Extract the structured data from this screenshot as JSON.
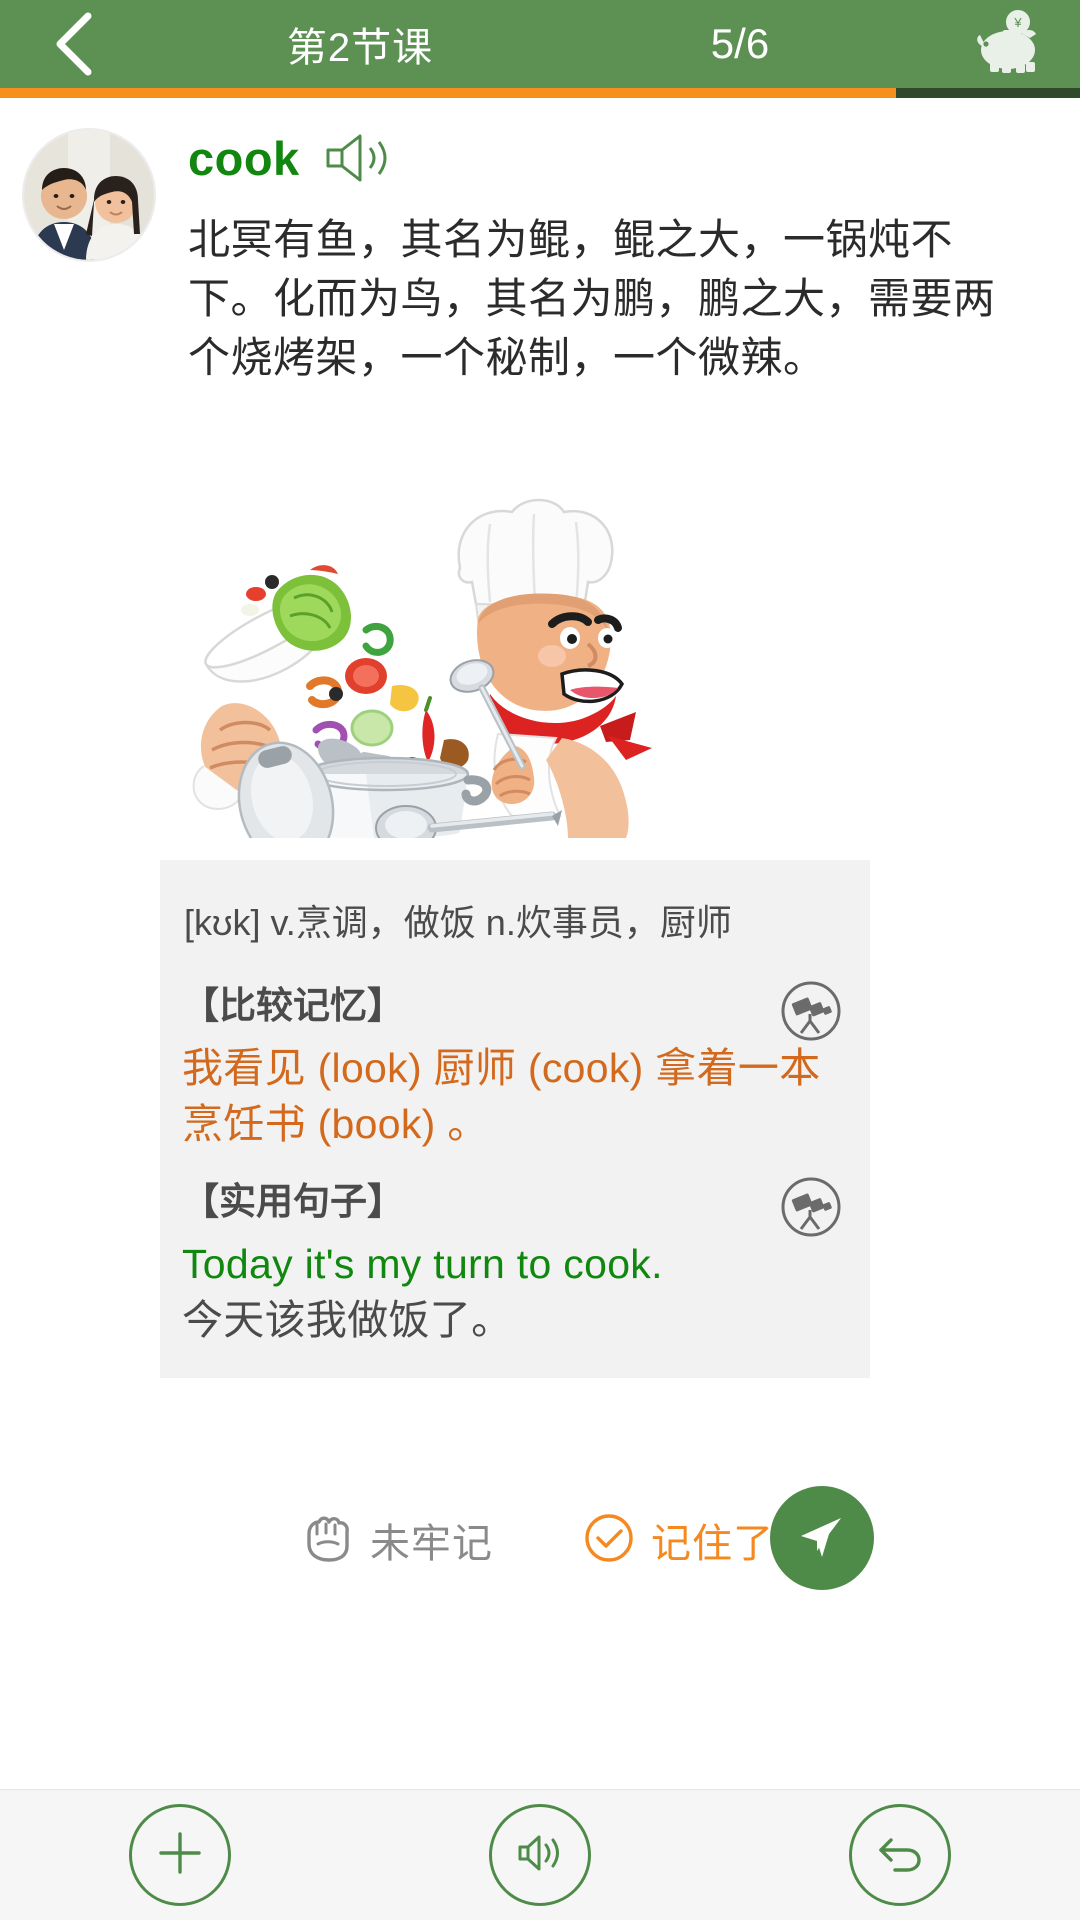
{
  "header": {
    "back_icon": "chevron-left-icon",
    "title": "第2节课",
    "counter": "5/6",
    "piggy_icon": "piggy-bank-icon",
    "progress_percent": 83,
    "bar_color": "#f78f1e",
    "bg_color": "#5d9154"
  },
  "card": {
    "avatar_alt": "couple-photo-avatar",
    "word": "cook",
    "speaker_icon": "speaker-icon",
    "paragraph": "北冥有鱼，其名为鲲，鲲之大，一锅炖不下。化而为鸟，其名为鹏，鹏之大，需要两个烧烤架，一个秘制，一个微辣。",
    "illustration_alt": "chef-cooking-illustration"
  },
  "definition": {
    "phonetic_line": "[kʊk] v.烹调，做饭 n.炊事员，厨师",
    "compare": {
      "heading": "【比较记忆】",
      "icon": "telescope-icon",
      "text": "我看见 (look) 厨师 (cook) 拿着一本烹饪书 (book) 。",
      "color": "#d2691c"
    },
    "sentence": {
      "heading": "【实用句子】",
      "icon": "telescope-icon",
      "english": "Today it's my turn to cook.",
      "chinese": "今天该我做饭了。",
      "english_color": "#10880f"
    }
  },
  "actions": {
    "forgot": {
      "icon": "fist-icon",
      "label": "未牢记",
      "color": "#8a8a8a"
    },
    "remember": {
      "icon": "check-circle-icon",
      "label": "记住了",
      "color": "#f5891f"
    },
    "send": {
      "icon": "paper-plane-icon",
      "color": "#4e8b49"
    }
  },
  "bottombar": {
    "items": [
      {
        "icon": "plus-circle-icon",
        "name": "add-button"
      },
      {
        "icon": "volume-circle-icon",
        "name": "sound-button"
      },
      {
        "icon": "undo-circle-icon",
        "name": "undo-button"
      }
    ],
    "outline_color": "#4e8b49"
  }
}
